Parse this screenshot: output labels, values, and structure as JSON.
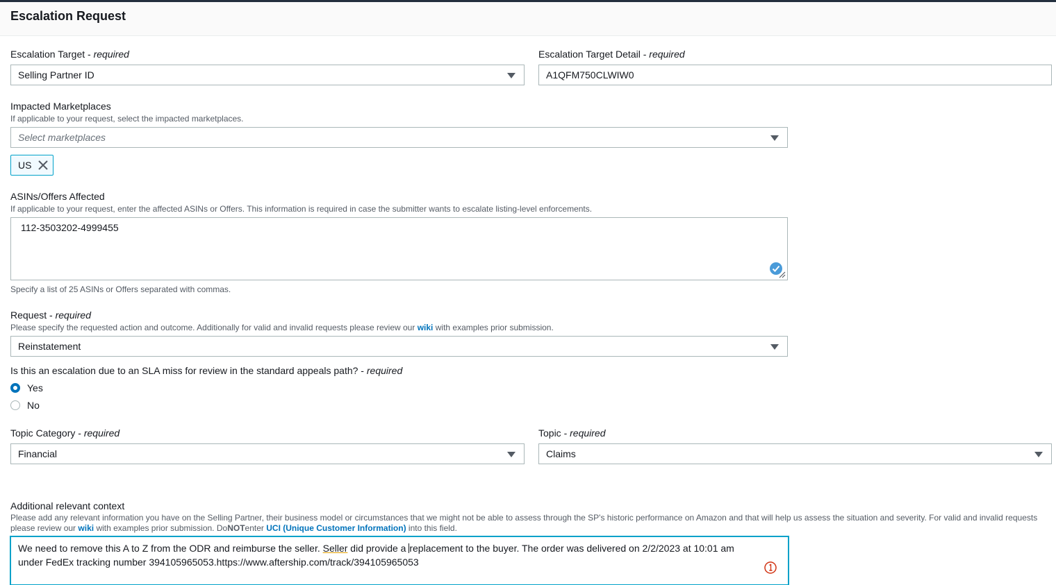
{
  "header": {
    "title": "Escalation Request"
  },
  "required_suffix": "required",
  "escalation_target": {
    "label": "Escalation Target",
    "value": "Selling Partner ID"
  },
  "escalation_target_detail": {
    "label": "Escalation Target Detail",
    "value": "A1QFM750CLWIW0"
  },
  "marketplaces": {
    "label": "Impacted Marketplaces",
    "description": "If applicable to your request, select the impacted marketplaces.",
    "placeholder": "Select marketplaces",
    "tokens": [
      "US"
    ]
  },
  "asins": {
    "label": "ASINs/Offers Affected",
    "description": "If applicable to your request, enter the affected ASINs or Offers. This information is required in case the submitter wants to escalate listing-level enforcements.",
    "value": "112-3503202-4999455",
    "hint": "Specify a list of 25 ASINs or Offers separated with commas."
  },
  "request": {
    "label": "Request",
    "description_before": "Please specify the requested action and outcome. Additionally for valid and invalid requests please review our",
    "link": "wiki",
    "description_after": "with examples prior submission.",
    "value": "Reinstatement"
  },
  "sla": {
    "question": "Is this an escalation due to an SLA miss for review in the standard appeals path?",
    "options": [
      {
        "label": "Yes",
        "selected": true
      },
      {
        "label": "No",
        "selected": false
      }
    ]
  },
  "topic_category": {
    "label": "Topic Category",
    "value": "Financial"
  },
  "topic": {
    "label": "Topic",
    "value": "Claims"
  },
  "context": {
    "label": "Additional relevant context",
    "desc_part1": "Please add any relevant information you have on the Selling Partner, their business model or circumstances that we might not be able to assess through the SP's historic performance on Amazon and that will help us assess the situation and severity. For valid and invalid requests please review our",
    "desc_link1": "wiki",
    "desc_part2": "with examples prior submission. Do",
    "desc_not": "NOT",
    "desc_part3": "enter",
    "desc_link2": "UCI (Unique Customer Information)",
    "desc_part4": "into this field.",
    "line1_a": "We need to remove this A to Z from the ODR and reimburse the seller.",
    "line1_spell": "Seller",
    "line1_b": "did provide a",
    "line1_c": "replacement to the buyer. The order was delivered on 2/2/2023 at 10:01 am",
    "line2": "under FedEx tracking number 394105965053.https://www.aftership.com/track/394105965053"
  },
  "colors": {
    "accent": "#0073bb",
    "focus": "#00a1c9",
    "error": "#d13212"
  }
}
